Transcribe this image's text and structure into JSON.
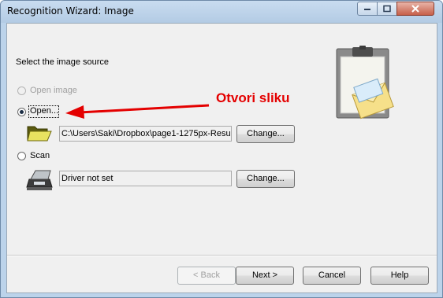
{
  "window": {
    "title": "Recognition Wizard: Image"
  },
  "page": {
    "heading": "Select the image source"
  },
  "options": {
    "open_image_label": "Open image",
    "open_label": "Open...",
    "open_path": "C:\\Users\\Saki\\Dropbox\\page1-1275px-Resu",
    "scan_label": "Scan",
    "scan_driver": "Driver not set",
    "change_label": "Change..."
  },
  "annotation": {
    "text": "Otvori sliku",
    "color": "#e40000"
  },
  "footer": {
    "back_label": "< Back",
    "next_label": "Next >",
    "cancel_label": "Cancel",
    "help_label": "Help"
  }
}
